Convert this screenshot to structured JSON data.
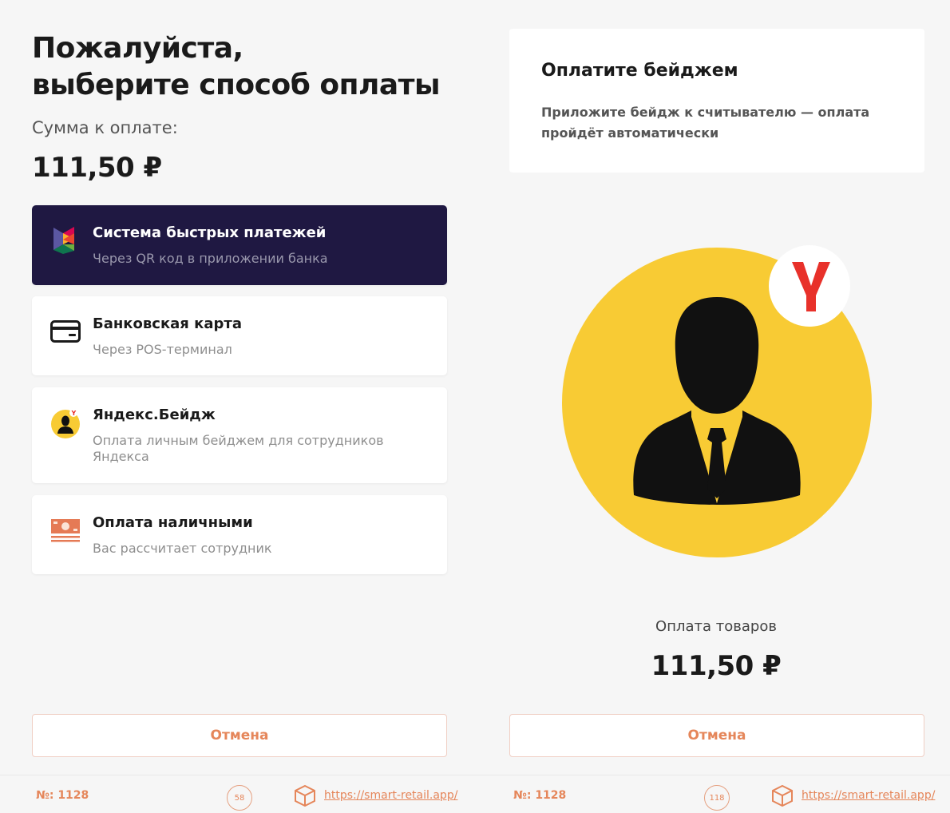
{
  "left": {
    "title_line1": "Пожалуйста,",
    "title_line2": "выберите способ оплаты",
    "sum_label": "Сумма к оплате:",
    "sum_value": "111,50 ₽",
    "options": [
      {
        "title": "Система быстрых платежей",
        "subtitle": "Через QR код в приложении банка",
        "icon": "sbp-logo-icon",
        "active": true
      },
      {
        "title": "Банковская карта",
        "subtitle": "Через POS-терминал",
        "icon": "credit-card-icon",
        "active": false
      },
      {
        "title": "Яндекс.Бейдж",
        "subtitle": "Оплата личным бейджем для сотрудников Яндекса",
        "icon": "yandex-badge-icon",
        "active": false
      },
      {
        "title": "Оплата наличными",
        "subtitle": "Вас рассчитает сотрудник",
        "icon": "cash-icon",
        "active": false
      }
    ],
    "cancel_label": "Отмена",
    "footer": {
      "order_no": "№: 1128",
      "timer": "58",
      "site": "https://smart-retail.app/"
    }
  },
  "right": {
    "card_title": "Оплатите бейджем",
    "card_text": "Приложите бейдж к считывателю — оплата пройдёт автоматически",
    "goods_label": "Оплата товаров",
    "goods_sum": "111,50 ₽",
    "cancel_label": "Отмена",
    "footer": {
      "order_no": "№: 1128",
      "timer": "118",
      "site": "https://smart-retail.app/"
    }
  },
  "colors": {
    "accent": "#e5865a",
    "active_bg": "#1f1842",
    "yandex_yellow": "#f8cb34",
    "yandex_red": "#e8312a"
  }
}
